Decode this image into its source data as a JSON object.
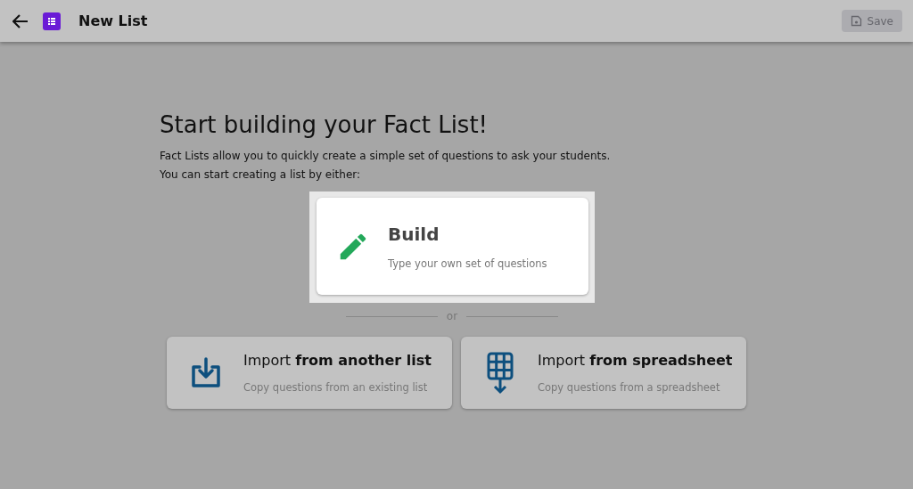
{
  "header": {
    "title": "New List",
    "save_button": {
      "label": "Save",
      "disabled": true
    }
  },
  "intro": {
    "heading": "Start building your Fact List!",
    "lines": [
      "Fact Lists allow you to quickly create a simple set of questions to ask your students.",
      "You can start creating a list by either:"
    ]
  },
  "primary_option": {
    "kind": "build",
    "title": "Build",
    "description": "Type your own set of questions",
    "highlighted": true
  },
  "divider_label": "or",
  "import_options": [
    {
      "kind": "import",
      "title": "Import **from another list**",
      "description": "Copy questions from an existing list",
      "highlighted": false
    },
    {
      "kind": "spreadsheet",
      "title": "Import **from spreadsheet**",
      "description": "Copy questions from a spreadsheet",
      "highlighted": false
    }
  ]
}
